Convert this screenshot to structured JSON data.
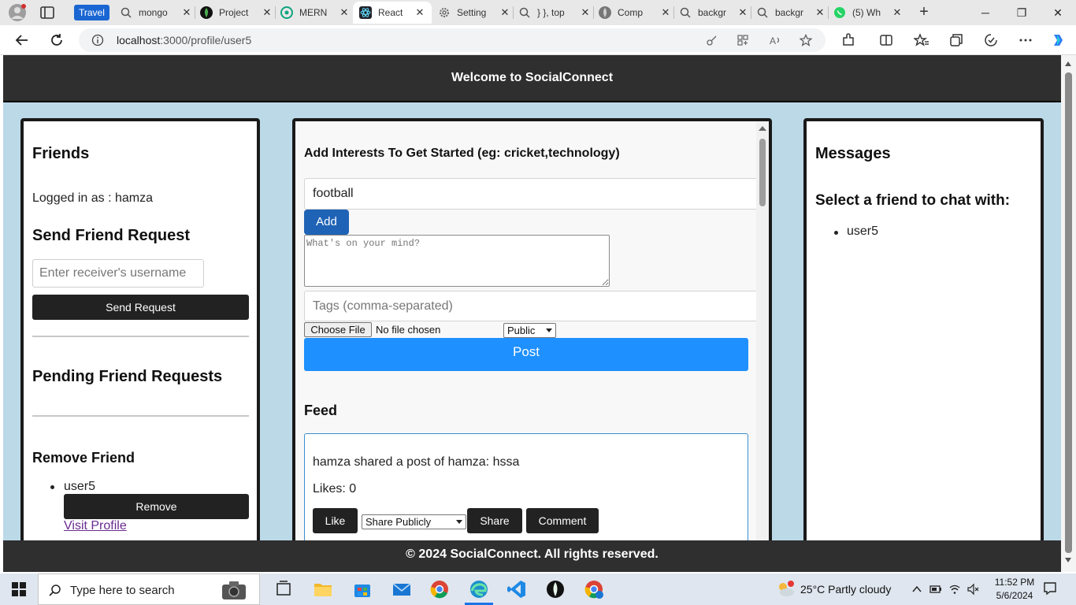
{
  "browser": {
    "tab_group_label": "Travel",
    "tabs": [
      {
        "label": "mongo",
        "icon": "search-icon"
      },
      {
        "label": "Project",
        "icon": "mongodb-leaf-icon"
      },
      {
        "label": "MERN",
        "icon": "chatgpt-icon"
      },
      {
        "label": "React",
        "icon": "react-icon",
        "active": true
      },
      {
        "label": "Setting",
        "icon": "gear-icon"
      },
      {
        "label": "} }, top",
        "icon": "search-icon"
      },
      {
        "label": "Comp",
        "icon": "mongodb-leaf-icon"
      },
      {
        "label": "backgr",
        "icon": "search-icon"
      },
      {
        "label": "backgr",
        "icon": "search-icon"
      },
      {
        "label": "(5) Wh",
        "icon": "whatsapp-icon"
      }
    ],
    "address": {
      "host": "localhost",
      "rest": ":3000/profile/user5"
    }
  },
  "app": {
    "header_title": "Welcome to SocialConnect",
    "footer_text": "© 2024 SocialConnect. All rights reserved."
  },
  "left": {
    "friends_title": "Friends",
    "logged_in": "Logged in as : hamza",
    "send_title": "Send Friend Request",
    "receiver_placeholder": "Enter receiver's username",
    "send_button": "Send Request",
    "pending_title": "Pending Friend Requests",
    "remove_title": "Remove Friend",
    "friends": [
      {
        "name": "user5",
        "remove_label": "Remove",
        "visit_label": "Visit Profile"
      }
    ]
  },
  "center": {
    "interests_title": "Add Interests To Get Started (eg: cricket,technology)",
    "interest_value": "football",
    "add_button": "Add",
    "mind_placeholder": "What's on your mind?",
    "tags_placeholder": "Tags (comma-separated)",
    "choose_file": "Choose File",
    "no_file": "No file chosen",
    "visibility_selected": "Public",
    "post_button": "Post",
    "feed_title": "Feed",
    "posts": [
      {
        "text": "hamza shared a post of hamza: hssa",
        "likes": "Likes: 0",
        "like_button": "Like",
        "share_option": "Share Publicly",
        "share_button": "Share",
        "comment_button": "Comment"
      }
    ]
  },
  "right": {
    "messages_title": "Messages",
    "select_title": "Select a friend to chat with:",
    "chat_friends": [
      "user5"
    ]
  },
  "taskbar": {
    "search_placeholder": "Type here to search",
    "weather": "25°C  Partly cloudy",
    "time": "11:52 PM",
    "date": "5/6/2024"
  },
  "colors": {
    "page_bg": "#bcd9e8",
    "header_bg": "#2f2f2f",
    "post_button": "#1e90ff",
    "add_button": "#1f63b6",
    "dark_button": "#222222",
    "link": "#6a2c91"
  }
}
